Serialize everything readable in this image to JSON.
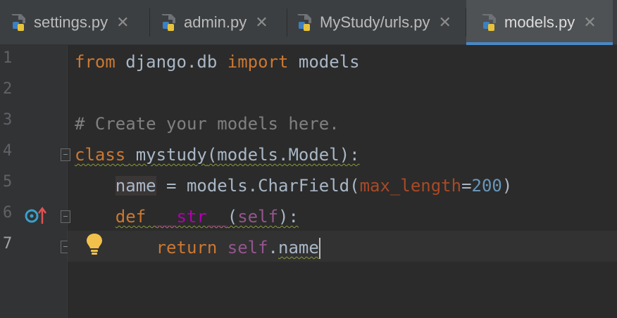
{
  "tabs": [
    {
      "label": "settings.py",
      "active": false
    },
    {
      "label": "admin.py",
      "active": false
    },
    {
      "label": "MyStudy/urls.py",
      "active": false
    },
    {
      "label": "models.py",
      "active": true
    }
  ],
  "close_glyph": "✕",
  "gutter": {
    "line_numbers": [
      "1",
      "2",
      "3",
      "4",
      "5",
      "6",
      "7"
    ],
    "current_line": "7"
  },
  "code": {
    "l1": {
      "kw_from": "from",
      "module": " django.db ",
      "kw_import": "import",
      "name": " models"
    },
    "l3": {
      "comment": "# Create your models here."
    },
    "l4": {
      "kw_class": "class",
      "space": " ",
      "class_name": "mystudy",
      "rest": "(models.Model):"
    },
    "l5": {
      "indent": "    ",
      "field": "name",
      "mid": " = models.CharField(",
      "param": "max_length",
      "eq": "=",
      "num": "200",
      "close": ")"
    },
    "l6": {
      "indent": "    ",
      "kw_def": "def",
      "space": " ",
      "method": "__str__",
      "open": "(",
      "self": "self",
      "close": "):"
    },
    "l7": {
      "indent": "        ",
      "kw_return": "return",
      "space": " ",
      "self": "self",
      "dot": ".",
      "attr": "name"
    }
  },
  "colors": {
    "keyword": "#cc7832",
    "comment": "#808080",
    "number": "#6897bb",
    "parameter": "#aa4926",
    "self": "#94558d",
    "magic": "#b200b2",
    "tab_accent": "#4a88c7"
  },
  "icons": [
    "python-file-icon",
    "override-method-icon",
    "lightbulb-icon",
    "fold-marker-icon"
  ]
}
